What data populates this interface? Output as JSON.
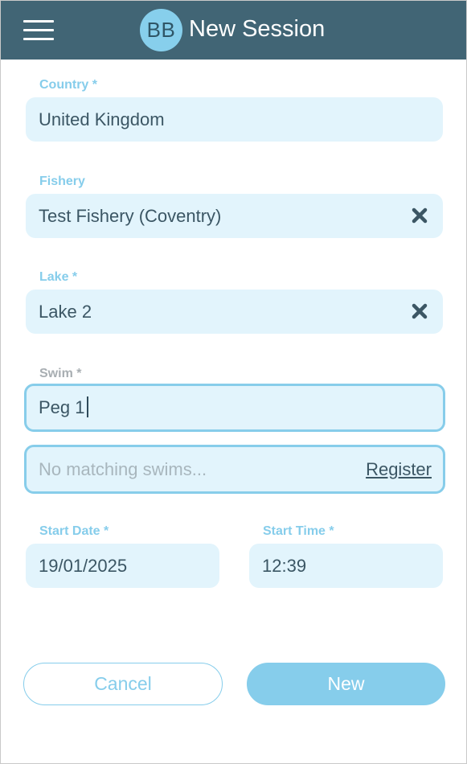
{
  "header": {
    "logo_text": "BB",
    "title": "New Session",
    "background": "#416575"
  },
  "form": {
    "country": {
      "label": "Country *",
      "value": "United Kingdom"
    },
    "fishery": {
      "label": "Fishery",
      "value": "Test Fishery (Coventry)"
    },
    "lake": {
      "label": "Lake *",
      "value": "Lake 2"
    },
    "swim": {
      "label": "Swim *",
      "value": "Peg 1"
    },
    "swim_suggestions": {
      "empty_text": "No matching swims...",
      "register_label": "Register"
    },
    "start_date": {
      "label": "Start Date *",
      "value": "19/01/2025"
    },
    "start_time": {
      "label": "Start Time *",
      "value": "12:39"
    }
  },
  "actions": {
    "cancel_label": "Cancel",
    "new_label": "New"
  },
  "colors": {
    "accent": "#86cdeb",
    "field_background": "#e2f4fc",
    "text": "#3b5664"
  },
  "icons": {
    "menu": "hamburger-menu-icon",
    "clear": "clear-x-icon"
  }
}
